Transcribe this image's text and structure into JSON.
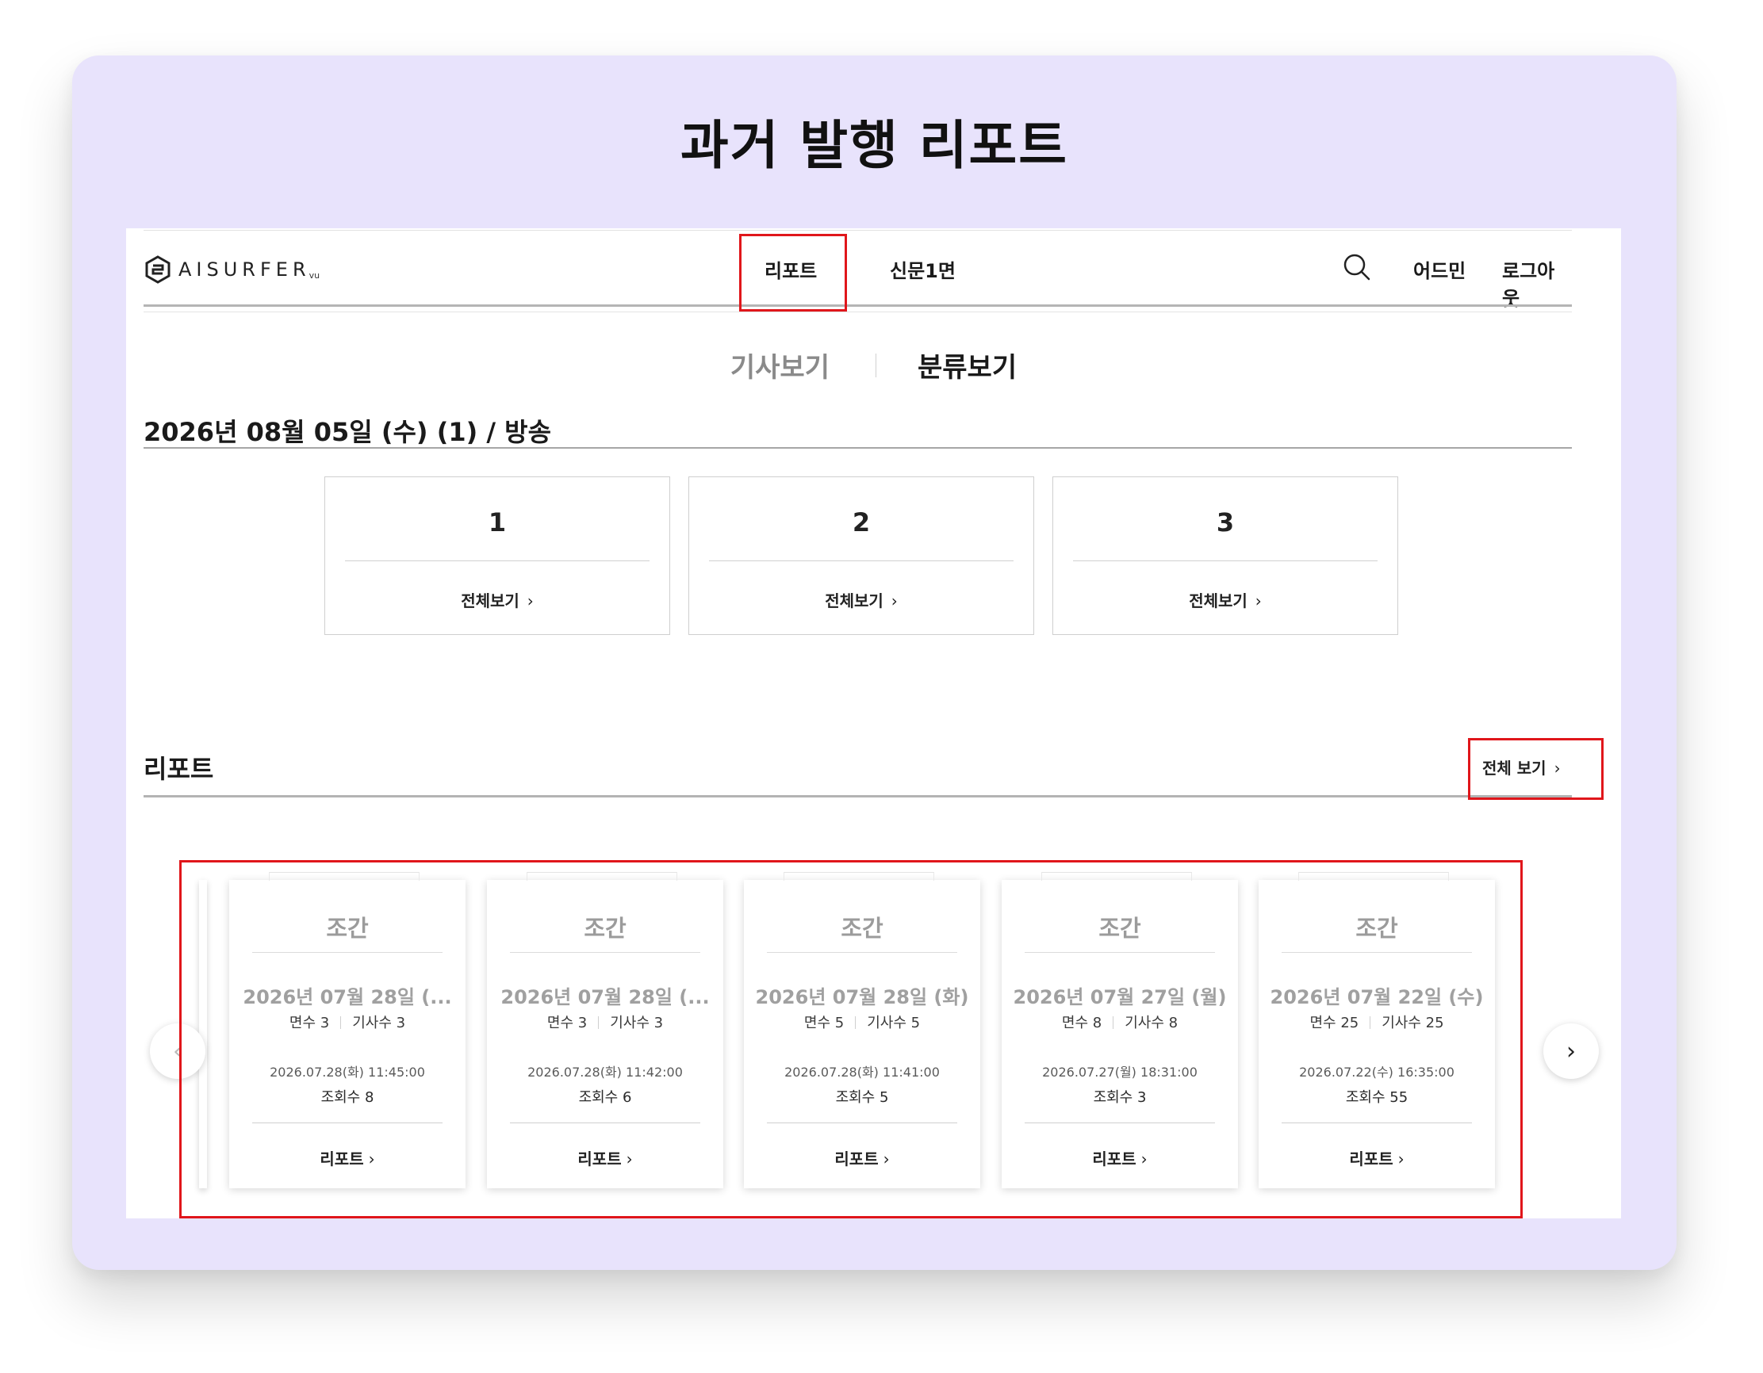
{
  "frame_title": "과거 발행 리포트",
  "header": {
    "logo_text": "AISURFER",
    "logo_sub": "vu",
    "nav": {
      "report": "리포트",
      "news_front": "신문1면"
    },
    "admin": "어드민",
    "logout": "로그아웃"
  },
  "tabs": {
    "article_view": "기사보기",
    "class_view": "분류보기"
  },
  "edition": {
    "heading": "2026년 08월 05일 (수) (1) / 방송",
    "boxes": [
      {
        "number": "1",
        "link": "전체보기"
      },
      {
        "number": "2",
        "link": "전체보기"
      },
      {
        "number": "3",
        "link": "전체보기"
      }
    ]
  },
  "reports": {
    "heading": "리포트",
    "view_all": "전체 보기",
    "cards": [
      {
        "edition": "조간",
        "date": "2026년 07월 28일 (...",
        "pages_label": "면수",
        "pages": "3",
        "articles_label": "기사수",
        "articles": "3",
        "time": "2026.07.28(화) 11:45:00",
        "views_label": "조회수",
        "views": "8",
        "link": "리포트"
      },
      {
        "edition": "조간",
        "date": "2026년 07월 28일 (...",
        "pages_label": "면수",
        "pages": "3",
        "articles_label": "기사수",
        "articles": "3",
        "time": "2026.07.28(화) 11:42:00",
        "views_label": "조회수",
        "views": "6",
        "link": "리포트"
      },
      {
        "edition": "조간",
        "date": "2026년 07월 28일 (화)",
        "pages_label": "면수",
        "pages": "5",
        "articles_label": "기사수",
        "articles": "5",
        "time": "2026.07.28(화) 11:41:00",
        "views_label": "조회수",
        "views": "5",
        "link": "리포트"
      },
      {
        "edition": "조간",
        "date": "2026년 07월 27일 (월)",
        "pages_label": "면수",
        "pages": "8",
        "articles_label": "기사수",
        "articles": "8",
        "time": "2026.07.27(월) 18:31:00",
        "views_label": "조회수",
        "views": "3",
        "link": "리포트"
      },
      {
        "edition": "조간",
        "date": "2026년 07월 22일 (수)",
        "pages_label": "면수",
        "pages": "25",
        "articles_label": "기사수",
        "articles": "25",
        "time": "2026.07.22(수) 16:35:00",
        "views_label": "조회수",
        "views": "55",
        "link": "리포트"
      }
    ]
  },
  "icons": {
    "search": "search-icon",
    "chevron_right": "chevron-right-icon",
    "chevron_left": "chevron-left-icon",
    "logo": "aisurfer-logo-icon"
  },
  "colors": {
    "frame_background": "#e8e3fc",
    "highlight": "#e0161b",
    "inactive_text": "#8a8a8a"
  }
}
